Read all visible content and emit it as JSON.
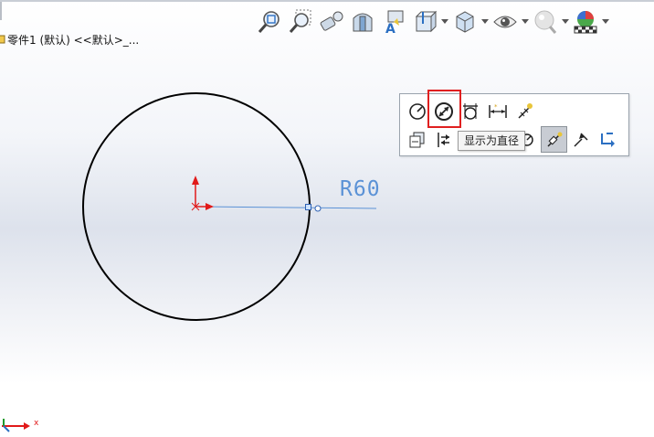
{
  "heads_up_toolbar": {
    "items": [
      {
        "name": "zoom-to-fit",
        "icon": "zoom-fit-icon"
      },
      {
        "name": "zoom-to-area",
        "icon": "zoom-area-icon"
      },
      {
        "name": "previous-view",
        "icon": "previous-view-icon"
      },
      {
        "name": "section-view",
        "icon": "section-view-icon"
      },
      {
        "name": "dynamic-annotation-views",
        "icon": "annotation-view-icon"
      },
      {
        "name": "view-orientation",
        "icon": "view-orientation-icon"
      },
      {
        "name": "display-style",
        "icon": "display-style-icon"
      },
      {
        "name": "hide-show-items",
        "icon": "eye-icon"
      },
      {
        "name": "edit-appearance",
        "icon": "appearance-icon"
      },
      {
        "name": "apply-scene",
        "icon": "scene-icon"
      }
    ]
  },
  "feature_tree": {
    "node_label": "零件1 (默认) <<默认>_...",
    "icon": "part-icon"
  },
  "sketch": {
    "dimension_text": "R60",
    "circle_color": "#000000",
    "leader_color": "#5b92d6",
    "origin_color": "#e11a1a"
  },
  "dimension_palette": {
    "row1": [
      {
        "name": "radius",
        "icon": "radius-icon"
      },
      {
        "name": "display-as-diameter",
        "icon": "diameter-icon"
      },
      {
        "name": "display-as-linear",
        "icon": "linear-icon"
      },
      {
        "name": "dimension-arc",
        "icon": "arc-dim-icon"
      },
      {
        "name": "smart-dimension",
        "icon": "smart-dim-icon"
      }
    ],
    "row2": [
      {
        "name": "copy-dimension",
        "icon": "copy-icon"
      },
      {
        "name": "reverse-direction",
        "icon": "reverse-icon"
      },
      {
        "name": "hidden-tool",
        "icon": "hidden-icon"
      },
      {
        "name": "dimension-tool",
        "icon": "dimension-tool-icon"
      },
      {
        "name": "selected-tool",
        "icon": "selected-tool-icon"
      },
      {
        "name": "arrow-tool",
        "icon": "arrow-tool-icon"
      },
      {
        "name": "return-tool",
        "icon": "return-icon"
      }
    ],
    "tooltip": "显示为直径",
    "highlight_color": "#e02020"
  }
}
